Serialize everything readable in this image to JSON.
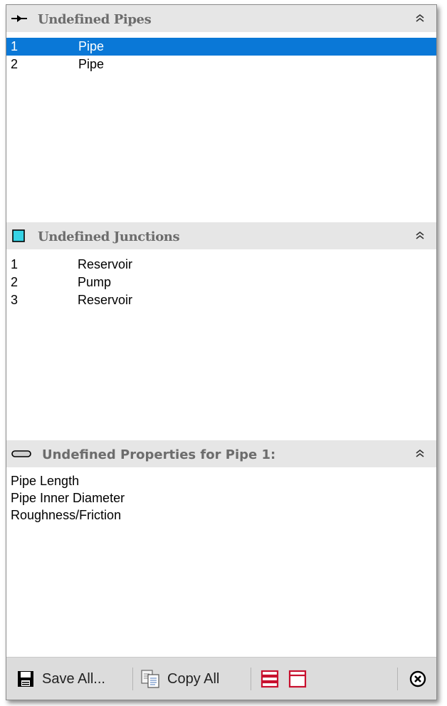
{
  "pipes_panel": {
    "title": "Undefined Pipes",
    "icon": "pipe-arrow-icon",
    "rows": [
      {
        "num": "1",
        "name": "Pipe",
        "selected": true
      },
      {
        "num": "2",
        "name": "Pipe",
        "selected": false
      }
    ]
  },
  "junctions_panel": {
    "title": "Undefined Junctions",
    "icon": "junction-square-icon",
    "icon_color": "#36d3e6",
    "rows": [
      {
        "num": "1",
        "name": "Reservoir"
      },
      {
        "num": "2",
        "name": "Pump"
      },
      {
        "num": "3",
        "name": "Reservoir"
      }
    ]
  },
  "properties_panel": {
    "title": "Undefined Properties for Pipe 1:",
    "icon": "pipe-segment-icon",
    "items": [
      "Pipe Length",
      "Pipe Inner Diameter",
      "Roughness/Friction"
    ]
  },
  "toolbar": {
    "save_all_label": "Save All...",
    "copy_all_label": "Copy All"
  },
  "colors": {
    "selection": "#0a78d7",
    "header_bg": "#e6e6e6",
    "toolbar_bg": "#dcdcdc",
    "accent_red": "#c8102e"
  }
}
